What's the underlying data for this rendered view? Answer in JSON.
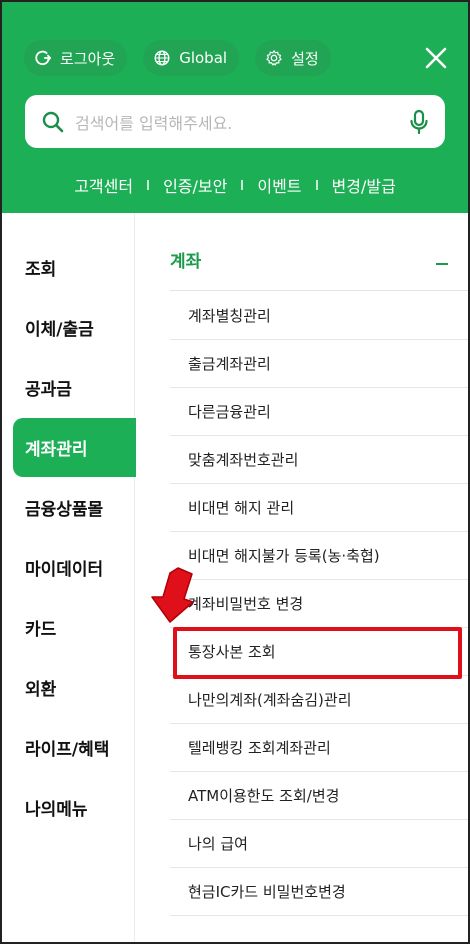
{
  "header": {
    "logout_label": "로그아웃",
    "global_label": "Global",
    "settings_label": "설정",
    "search_placeholder": "검색어를 입력해주세요.",
    "quick_links": [
      "고객센터",
      "인증/보안",
      "이벤트",
      "변경/발급"
    ]
  },
  "categories": [
    "조회",
    "이체/출금",
    "공과금",
    "계좌관리",
    "금융상품몰",
    "마이데이터",
    "카드",
    "외환",
    "라이프/혜택",
    "나의메뉴"
  ],
  "active_category": "계좌관리",
  "section": {
    "title": "계좌",
    "toggle": "−",
    "items": [
      "계좌별칭관리",
      "출금계좌관리",
      "다른금융관리",
      "맞춤계좌번호관리",
      "비대면 해지 관리",
      "비대면 해지불가 등록(농·축협)",
      "계좌비밀번호 변경",
      "통장사본 조회",
      "나만의계좌(계좌숨김)관리",
      "텔레뱅킹 조회계좌관리",
      "ATM이용한도 조회/변경",
      "나의 급여",
      "현금IC카드 비밀번호변경"
    ]
  },
  "highlighted_item": "통장사본 조회",
  "colors": {
    "brand_green": "#1daf55",
    "section_green": "#1a9b4b",
    "annotation_red": "#e0101a"
  }
}
